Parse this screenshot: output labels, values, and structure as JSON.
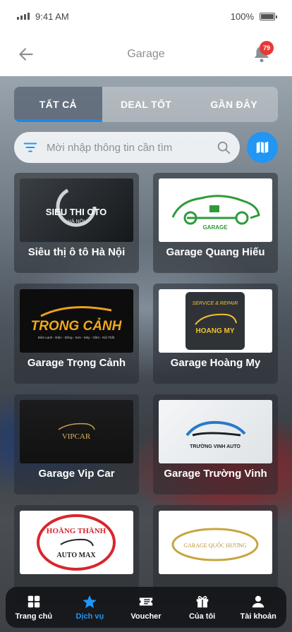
{
  "status": {
    "time": "9:41 AM",
    "battery": "100%"
  },
  "header": {
    "title": "Garage",
    "notification_count": "79"
  },
  "tabs": [
    {
      "label": "TẤT CẢ",
      "active": true
    },
    {
      "label": "DEAL TỐT",
      "active": false
    },
    {
      "label": "GẦN ĐÂY",
      "active": false
    }
  ],
  "search": {
    "placeholder": "Mời nhập thông tin cần tìm",
    "value": ""
  },
  "garages": [
    {
      "name": "Siêu thị ô tô Hà Nội",
      "logo_text": "SIEU THI OTO",
      "logo_sub": "HÀ NỘI"
    },
    {
      "name": "Garage Quang Hiếu",
      "logo_text": "GARAGE",
      "logo_sub": ""
    },
    {
      "name": "Garage Trọng Cảnh",
      "logo_text": "TRONG CẢNH",
      "logo_sub": "Điện Lạnh - Điện - Đồng - Sơn - Máy - Gầm - Nội Thất"
    },
    {
      "name": "Garage Hoàng My",
      "logo_text": "HOANG MY",
      "logo_sub": "SERVICE & REPAIR"
    },
    {
      "name": "Garage Vip Car",
      "logo_text": "VIPCAR",
      "logo_sub": ""
    },
    {
      "name": "Garage Trường Vinh",
      "logo_text": "TRƯỜNG VINH AUTO",
      "logo_sub": ""
    },
    {
      "name": "",
      "logo_text": "HOÀNG THÀNH",
      "logo_sub": "AUTO MAX"
    },
    {
      "name": "",
      "logo_text": "GARAGE QUỐC HƯƠNG",
      "logo_sub": ""
    }
  ],
  "nav": [
    {
      "label": "Trang chủ",
      "icon": "grid-icon",
      "active": false
    },
    {
      "label": "Dịch vụ",
      "icon": "star-icon",
      "active": true
    },
    {
      "label": "Voucher",
      "icon": "voucher-icon",
      "active": false
    },
    {
      "label": "Của tôi",
      "icon": "gift-icon",
      "active": false
    },
    {
      "label": "Tài khoản",
      "icon": "user-icon",
      "active": false
    }
  ],
  "colors": {
    "accent": "#2196f3",
    "badge": "#e53935"
  }
}
